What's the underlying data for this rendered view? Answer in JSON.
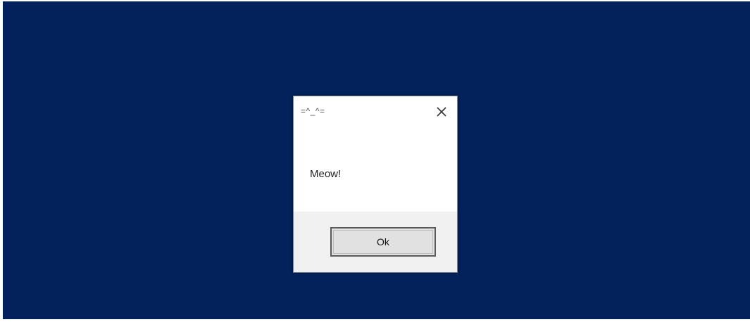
{
  "dialog": {
    "title": "=^_^=",
    "message": "Meow!",
    "ok_label": "Ok",
    "close_icon": "close-icon"
  },
  "colors": {
    "desktop_background": "#03215a",
    "dialog_background": "#ffffff",
    "footer_background": "#f0f0f0"
  }
}
